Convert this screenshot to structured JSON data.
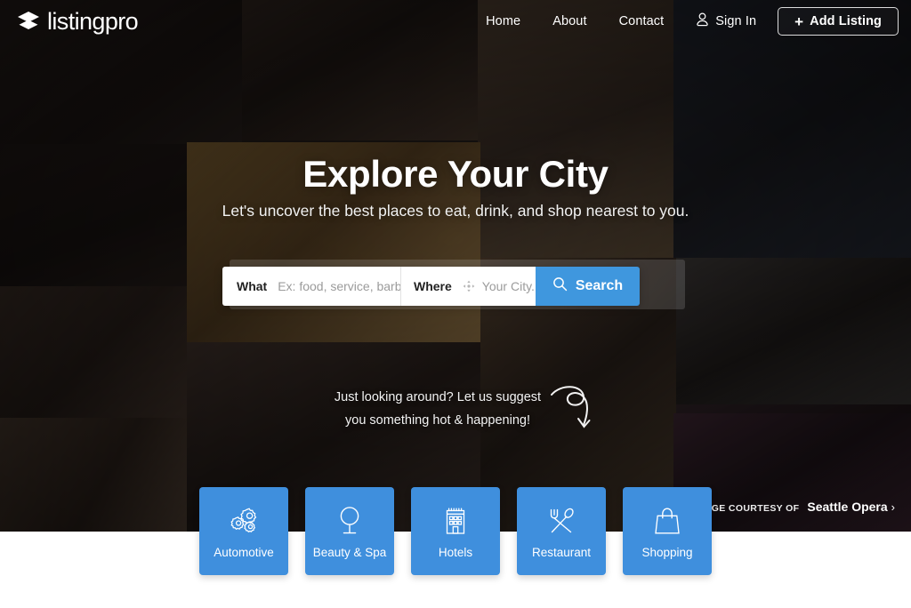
{
  "brand": {
    "name": "listingpro",
    "logo_icon": "layers-icon"
  },
  "nav": {
    "links": [
      {
        "label": "Home",
        "name": "nav-home"
      },
      {
        "label": "About",
        "name": "nav-about"
      },
      {
        "label": "Contact",
        "name": "nav-contact"
      }
    ],
    "sign_in": {
      "label": "Sign In",
      "icon": "user-icon"
    },
    "add_listing": {
      "label": "Add Listing",
      "icon": "plus-icon"
    }
  },
  "hero": {
    "title": "Explore Your City",
    "subtitle": "Let's uncover the best places to eat, drink, and shop nearest to you.",
    "suggest_line1": "Just looking around? Let us suggest",
    "suggest_line2": "you something hot & happening!",
    "suggest_icon": "curved-arrow-icon"
  },
  "search": {
    "what_label": "What",
    "what_placeholder": "Ex: food, service, barber,",
    "what_value": "",
    "where_label": "Where",
    "where_placeholder": "Your City...",
    "where_value": "",
    "where_icon": "locate-crosshair-icon",
    "button_label": "Search",
    "button_icon": "magnifier-icon"
  },
  "categories": [
    {
      "label": "Automotive",
      "icon": "gears-icon"
    },
    {
      "label": "Beauty & Spa",
      "icon": "mirror-icon"
    },
    {
      "label": "Hotels",
      "icon": "building-icon"
    },
    {
      "label": "Restaurant",
      "icon": "fork-spoon-icon"
    },
    {
      "label": "Shopping",
      "icon": "shopping-bag-icon"
    }
  ],
  "courtesy": {
    "prefix": "IMAGE COURTESY OF",
    "name": "Seattle Opera",
    "chevron": "›"
  },
  "colors": {
    "accent_blue": "#3f97de",
    "tile_blue": "#3f8fdd",
    "text_white": "#ffffff",
    "placeholder_gray": "#9b9b9b"
  }
}
